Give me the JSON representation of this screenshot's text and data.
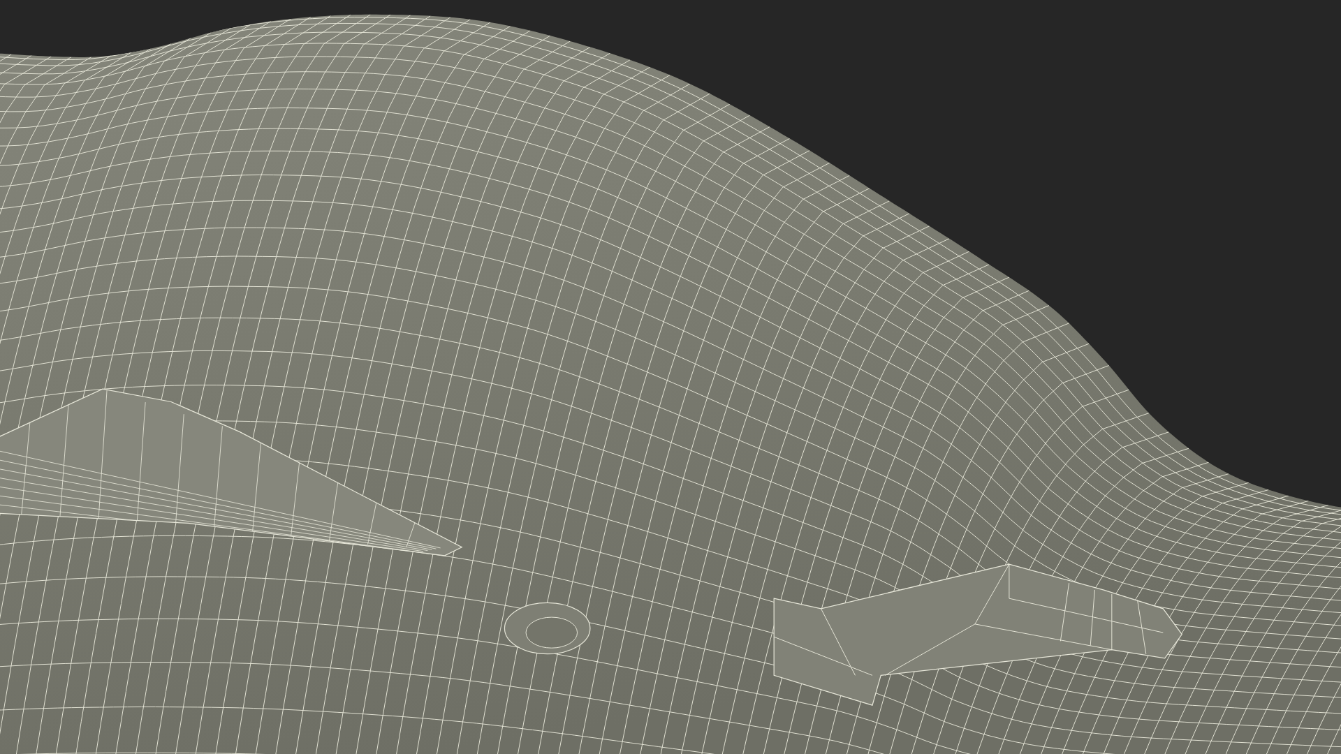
{
  "scene": {
    "kind": "wireframe"
  }
}
